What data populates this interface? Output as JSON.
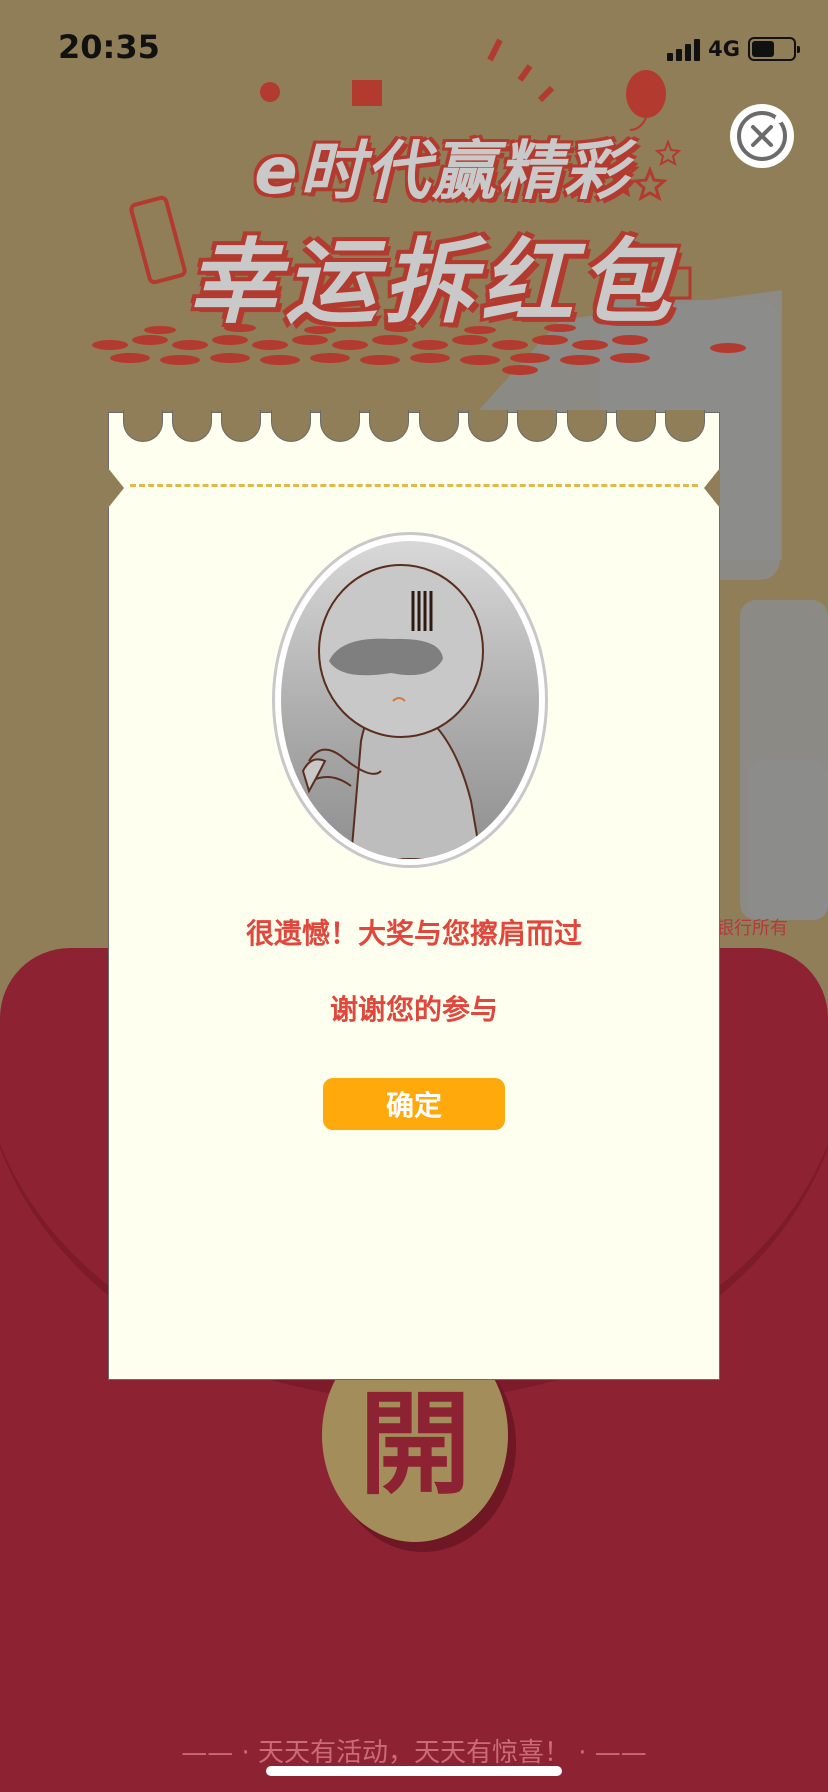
{
  "status_bar": {
    "time": "20:35",
    "network": "4G",
    "battery_level": 0.55
  },
  "banner": {
    "title_line1": "e时代赢精彩",
    "title_line2": "幸运拆红包"
  },
  "background": {
    "open_char": "開",
    "bank_text": "银行所有",
    "footer_slogan": "—— · 天天有活动，天天有惊喜！ · ——"
  },
  "modal": {
    "message_main": "很遗憾！大奖与您擦肩而过",
    "message_sub": "谢谢您的参与",
    "confirm_label": "确定"
  },
  "colors": {
    "background": "#8f7e57",
    "envelope_red": "#8d2232",
    "message_red": "#e0473d",
    "confirm_orange": "#ffa90d",
    "ticket_bg": "#fffff0"
  },
  "icons": {
    "close": "close-circle-icon",
    "signal": "signal-icon",
    "battery": "battery-icon"
  }
}
